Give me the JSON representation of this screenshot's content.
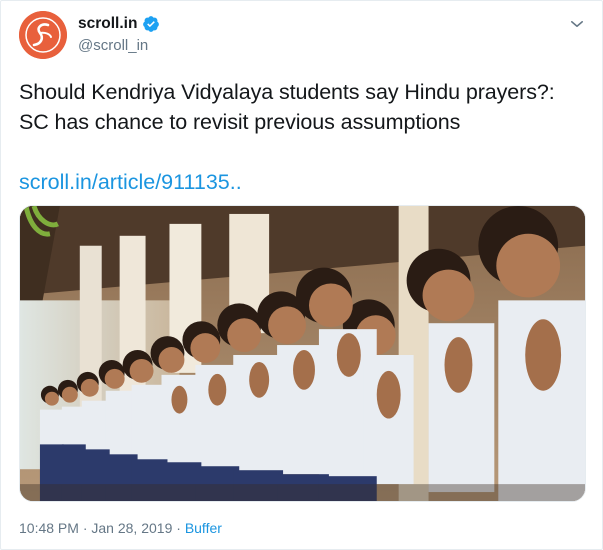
{
  "account": {
    "display_name": "scroll.in",
    "handle": "@scroll_in",
    "avatar_icon": "scroll-logo-icon",
    "avatar_color": "#e8603c",
    "verified": true
  },
  "tweet": {
    "text_line1": "Should Kendriya Vidyalaya students say Hindu prayers?:",
    "text_line2": "SC has chance to revisit previous assumptions",
    "link_text": "scroll.in/article/911135..",
    "photo_icon": "students-praying-photo"
  },
  "meta": {
    "time": "10:48 PM",
    "separator1": " · ",
    "date": "Jan 28, 2019",
    "separator2": " · ",
    "source": "Buffer"
  },
  "colors": {
    "link": "#1b95e0",
    "muted": "#657786",
    "text": "#14171a"
  }
}
